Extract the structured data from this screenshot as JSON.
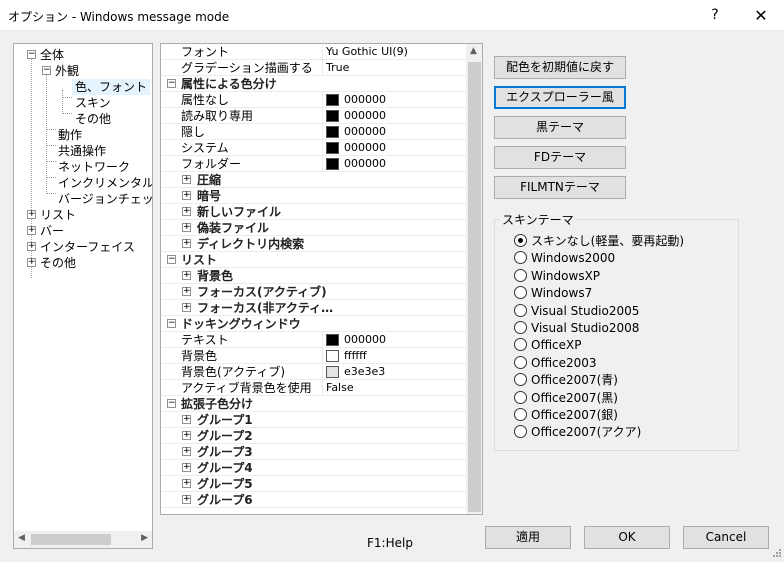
{
  "window": {
    "title": "オプション - Windows message mode",
    "help_glyph": "?",
    "close_glyph": "✕"
  },
  "tree": {
    "items": [
      "全体",
      "外観",
      "色、フォント",
      "スキン",
      "その他",
      "動作",
      "共通操作",
      "ネットワーク",
      "インクリメンタルサー",
      "バージョンチェック",
      "リスト",
      "バー",
      "インターフェイス",
      "その他"
    ],
    "expanded_glyph": "−",
    "collapsed_glyph": "+"
  },
  "grid": {
    "rows": [
      {
        "name": "フォント",
        "value": "Yu Gothic UI(9)"
      },
      {
        "name": "グラデーション描画する",
        "value": "True"
      },
      {
        "cat": "属性による色分け"
      },
      {
        "name": "属性なし",
        "value": "000000"
      },
      {
        "name": "読み取り専用",
        "value": "000000"
      },
      {
        "name": "隠し",
        "value": "000000"
      },
      {
        "name": "システム",
        "value": "000000"
      },
      {
        "name": "フォルダー",
        "value": "000000"
      },
      {
        "sub": "圧縮"
      },
      {
        "sub": "暗号"
      },
      {
        "sub": "新しいファイル"
      },
      {
        "sub": "偽装ファイル"
      },
      {
        "sub": "ディレクトリ内検索"
      },
      {
        "cat": "リスト"
      },
      {
        "sub": "背景色"
      },
      {
        "sub": "フォーカス(アクティブ)"
      },
      {
        "sub": "フォーカス(非アクティ…"
      },
      {
        "cat": "ドッキングウィンドウ"
      },
      {
        "name": "テキスト",
        "value": "000000"
      },
      {
        "name": "背景色",
        "value": "ffffff"
      },
      {
        "name": "背景色(アクティブ)",
        "value": "e3e3e3"
      },
      {
        "name": "アクティブ背景色を使用",
        "value": "False"
      },
      {
        "cat": "拡張子色分け"
      },
      {
        "sub": "グループ1"
      },
      {
        "sub": "グループ2"
      },
      {
        "sub": "グループ3"
      },
      {
        "sub": "グループ4"
      },
      {
        "sub": "グループ5"
      },
      {
        "sub": "グループ6"
      }
    ]
  },
  "buttons": {
    "reset_colors": "配色を初期値に戻す",
    "explorer_theme": "エクスプローラー風",
    "black_theme": "黒テーマ",
    "fd_theme": "FDテーマ",
    "filmtn_theme": "FILMTNテーマ",
    "apply": "適用",
    "ok": "OK",
    "cancel": "Cancel"
  },
  "skin": {
    "legend": "スキンテーマ",
    "options": [
      "スキンなし(軽量、要再起動)",
      "Windows2000",
      "WindowsXP",
      "Windows7",
      "Visual Studio2005",
      "Visual Studio2008",
      "OfficeXP",
      "Office2003",
      "Office2007(青)",
      "Office2007(黒)",
      "Office2007(銀)",
      "Office2007(アクア)"
    ],
    "selected_index": 0
  },
  "status": {
    "help": "F1:Help"
  },
  "colors": {
    "black": "#000000",
    "white": "#ffffff",
    "light_gray": "#e3e3e3",
    "focus_blue": "#0078d7"
  }
}
